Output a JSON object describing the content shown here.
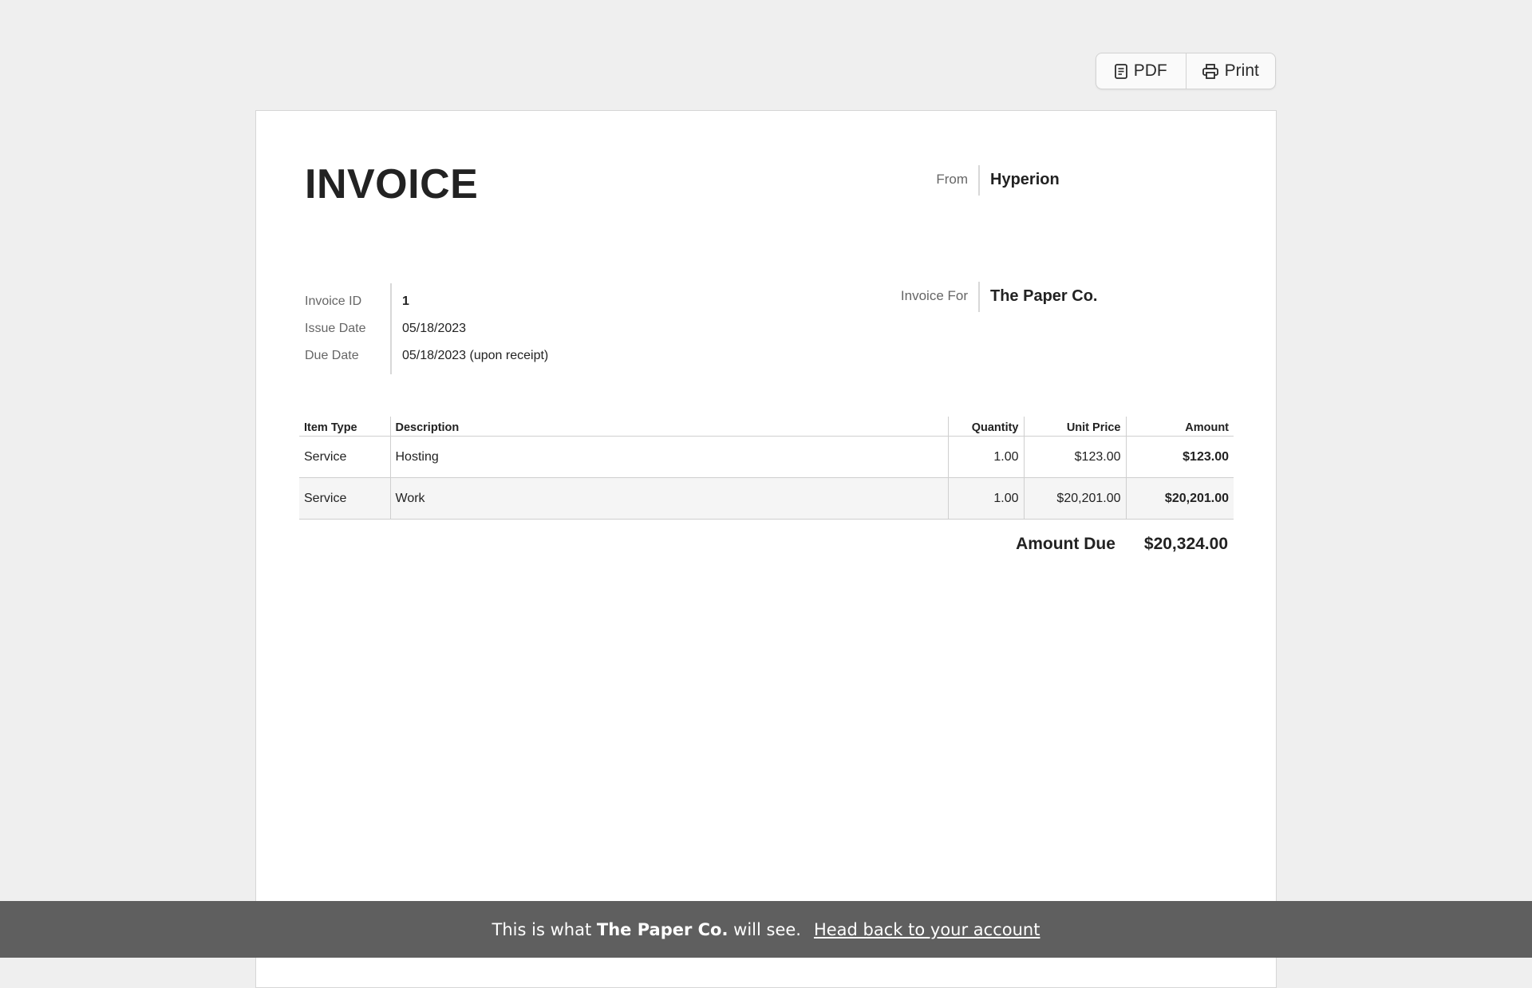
{
  "toolbar": {
    "pdf_label": "PDF",
    "pdf_icon": "document-icon",
    "print_label": "Print",
    "print_icon": "printer-icon"
  },
  "invoice": {
    "title": "INVOICE",
    "from_label": "From",
    "from_value": "Hyperion",
    "for_label": "Invoice For",
    "for_value": "The Paper Co.",
    "meta": {
      "id_label": "Invoice ID",
      "id_value": "1",
      "issue_label": "Issue Date",
      "issue_value": "05/18/2023",
      "due_label": "Due Date",
      "due_value": "05/18/2023 (upon receipt)"
    },
    "table": {
      "headers": [
        "Item Type",
        "Description",
        "Quantity",
        "Unit Price",
        "Amount"
      ],
      "rows": [
        [
          "Service",
          "Hosting",
          "1.00",
          "$123.00",
          "$123.00"
        ],
        [
          "Service",
          "Work",
          "1.00",
          "$20,201.00",
          "$20,201.00"
        ]
      ]
    },
    "amount_due_label": "Amount Due",
    "amount_due_value": "$20,324.00"
  },
  "banner": {
    "prefix": "This is what",
    "name": "The Paper Co.",
    "suffix": "will see.",
    "link": "Head back to your account"
  }
}
